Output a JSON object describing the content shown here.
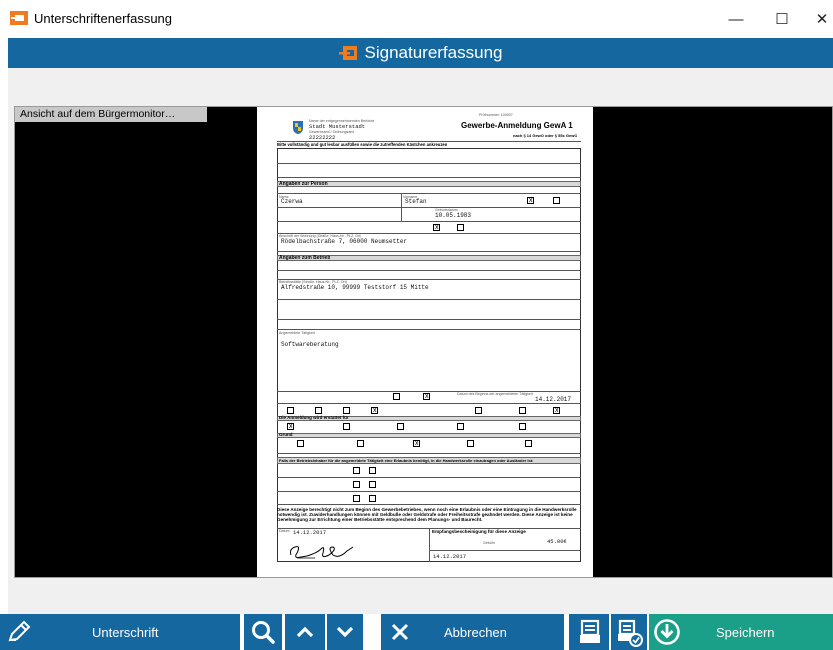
{
  "window": {
    "title": "Unterschriftenerfassung",
    "min_icon": "minimize-icon",
    "max_icon": "maximize-icon",
    "close_icon": "close-icon",
    "min_glyph": "—",
    "max_glyph": "☐",
    "close_glyph": "✕"
  },
  "header": {
    "title": "Signaturerfassung",
    "icon": "signature-app-icon",
    "accent": "#14679f",
    "icon_color": "#f07b21"
  },
  "monitor": {
    "label": "Ansicht auf dem Bürgermonitor…"
  },
  "form": {
    "doc_number": "Prüfnummer: 100007",
    "authority_label": "Name der entgegennehmenden Behörde",
    "authority": "Stadt Musterstadt",
    "office_label": "Gewerbeamt / Ordnungsamt",
    "office_code": "22222222",
    "form_title": "Gewerbe-Anmeldung GewA 1",
    "form_subtitle": "nach § 14 GewO oder § 55c GewO",
    "intro": "Bitte vollständig und gut lesbar ausfüllen sowie die zutreffenden Kästchen ankreuzen",
    "sec_person": "Angaben zur Person",
    "name_label": "Name",
    "name": "Czerwa",
    "firstname_label": "Vorname",
    "firstname": "Stefan",
    "birth_label": "Geburtsdatum",
    "birthdate": "10.05.1983",
    "address_label": "Anschrift der Wohnung (Straße, Haus-Nr., PLZ, Ort)",
    "address": "Rödelbachstraße 7, 06000 Neumsetter",
    "sec_business": "Angaben zum Betrieb",
    "business_address_label": "Betriebsstätte (Straße, Haus-Nr., PLZ, Ort)",
    "business_address": "Alfredstraße 10, 99999 Teststorf 15 Mitte",
    "activity_label": "Angemeldete Tätigkeit",
    "activity": "Softwareberatung",
    "start_label": "Datum des Beginns der angemeldeten Tätigkeit",
    "start_date": "14.12.2017",
    "sec_reason": "Die Anmeldung wird erstattet für",
    "sec_grund": "Grund",
    "sec_erlaubnis": "Falls der Betriebsinhaber für die angemeldete Tätigkeit eine Erlaubnis benötigt, in die Handwerksrolle einzutragen oder Ausländer ist:",
    "hint": "Diese Anzeige berechtigt nicht zum Beginn des Gewerbebetriebes, wenn noch eine Erlaubnis oder eine Eintragung in die Handwerksrolle notwendig ist. Zuwiderhandlungen können mit Geldbuße oder Geldstrafe oder Freiheitsstrafe geahndet werden. Diese Anzeige ist keine Genehmigung zur Errichtung einer Betriebsstätte entsprechend dem Planungs- und Baurecht.",
    "sign_date_label": "Datum",
    "sign_date": "14.12.2017",
    "receipt_title": "Empfangsbescheinigung für diese Anzeige",
    "fee_label": "Gebühr",
    "fee": "45.00€",
    "receipt_date": "14.12.2017",
    "signature_icon": "handwritten-signature"
  },
  "toolbar": {
    "sign_label": "Unterschrift",
    "sign_icon": "pen-icon",
    "zoom_icon": "magnifier-icon",
    "up_icon": "chevron-up-icon",
    "down_icon": "chevron-down-icon",
    "cancel_label": "Abbrechen",
    "cancel_icon": "close-x-icon",
    "print_icon": "printer-icon",
    "print_config_icon": "printer-settings-icon",
    "save_icon": "download-circle-icon",
    "save_label": "Speichern",
    "save_color": "#1a9f88"
  }
}
